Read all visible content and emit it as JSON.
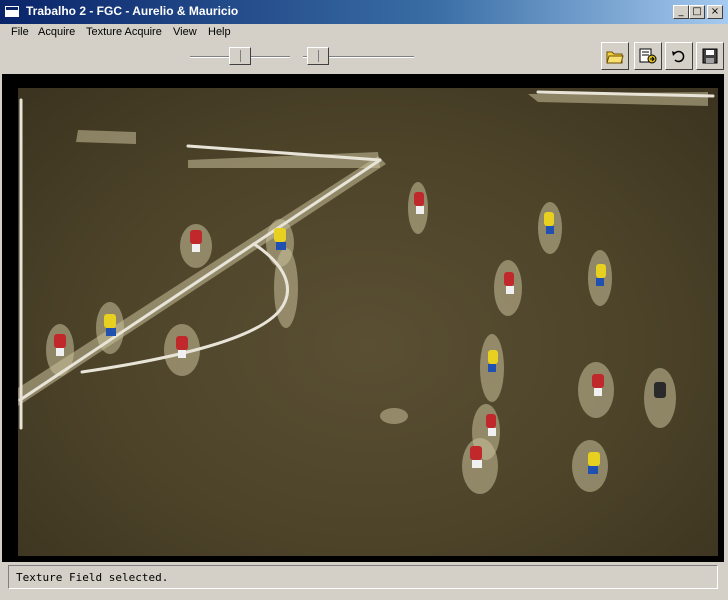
{
  "window": {
    "title": "Trabalho 2 - FGC - Aurelio & Mauricio"
  },
  "title_buttons": {
    "minimize": "_",
    "maximize": "□",
    "close": "×"
  },
  "menu": [
    "File",
    "Acquire",
    "Texture Acquire",
    "View",
    "Help"
  ],
  "toolbar": {
    "sliders": [
      {
        "name": "slider-1",
        "value": 0.5
      },
      {
        "name": "slider-2",
        "value": 0.05
      }
    ],
    "buttons": [
      "open-folder-icon",
      "export-icon",
      "undo-icon",
      "save-icon"
    ]
  },
  "status": {
    "text": "Texture Field selected."
  },
  "colors": {
    "title_bar": "#0a246a",
    "field_grass": "#4c4329",
    "texture_overlay": "#c8c09a",
    "team_red": "#c0282c",
    "team_yellow": "#e8d020"
  }
}
